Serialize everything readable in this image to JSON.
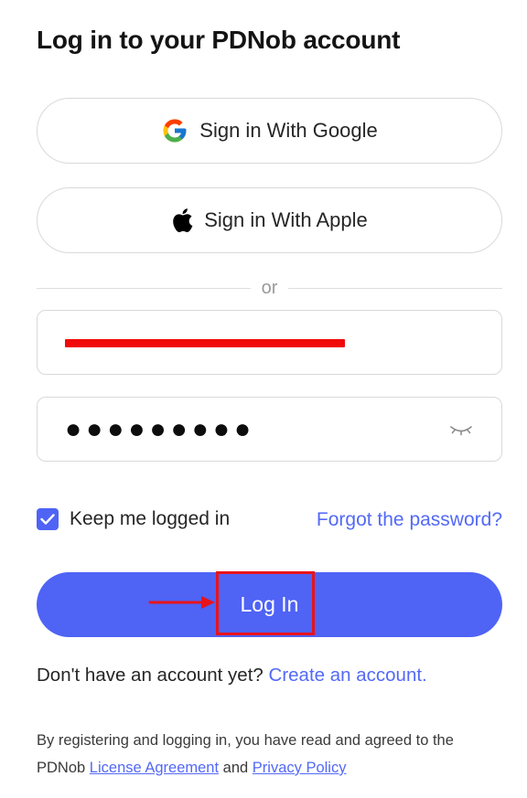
{
  "header": {
    "title": "Log in to your PDNob account"
  },
  "social": {
    "google_label": "Sign in With Google",
    "apple_label": "Sign in With Apple"
  },
  "divider": {
    "text": "or"
  },
  "form": {
    "email_value": "",
    "email_redacted": true,
    "password_mask": "●●●●●●●●●",
    "remember_label": "Keep me logged in",
    "remember_checked": true,
    "forgot_label": "Forgot the password?",
    "login_label": "Log In"
  },
  "signup": {
    "prompt": "Don't have an account yet?",
    "link": "Create an account."
  },
  "legal": {
    "text_part1": "By registering and logging in, you have read and agreed to the PDNob",
    "license_link": "License Agreement",
    "and": "and",
    "privacy_link": "Privacy Policy"
  },
  "colors": {
    "accent": "#4f63f5",
    "link": "#5369f5",
    "annotation_red": "#e8131b",
    "border": "#d9d9d9"
  },
  "icons": {
    "google": "google-icon",
    "apple": "apple-icon",
    "eye": "eye-closed-icon",
    "check": "check-icon",
    "arrow": "arrow-right-icon"
  }
}
